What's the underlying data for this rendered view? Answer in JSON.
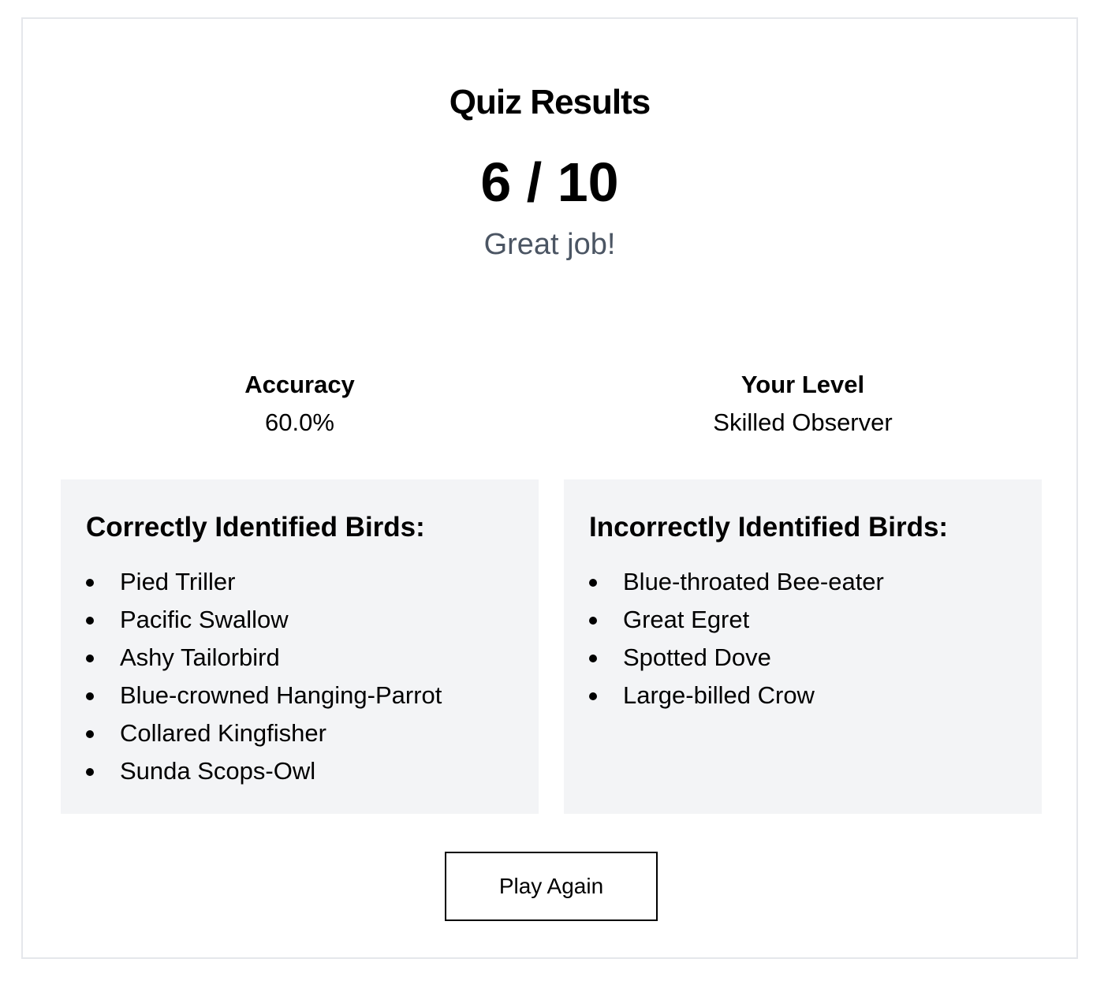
{
  "results": {
    "title": "Quiz Results",
    "score": "6 / 10",
    "message": "Great job!",
    "score_value": {
      "correct": 6,
      "total": 10
    }
  },
  "stats": {
    "accuracy_label": "Accuracy",
    "accuracy_value": "60.0%",
    "level_label": "Your Level",
    "level_value": "Skilled Observer"
  },
  "correct": {
    "title": "Correctly Identified Birds:",
    "birds": [
      "Pied Triller",
      "Pacific Swallow",
      "Ashy Tailorbird",
      "Blue-crowned Hanging-Parrot",
      "Collared Kingfisher",
      "Sunda Scops-Owl"
    ]
  },
  "incorrect": {
    "title": "Incorrectly Identified Birds:",
    "birds": [
      "Blue-throated Bee-eater",
      "Great Egret",
      "Spotted Dove",
      "Large-billed Crow"
    ]
  },
  "actions": {
    "play_again_label": "Play Again"
  },
  "colors": {
    "panel_background": "#f3f4f6",
    "card_border": "#e5e7eb",
    "message_text": "#4b5563",
    "text": "#000000"
  }
}
